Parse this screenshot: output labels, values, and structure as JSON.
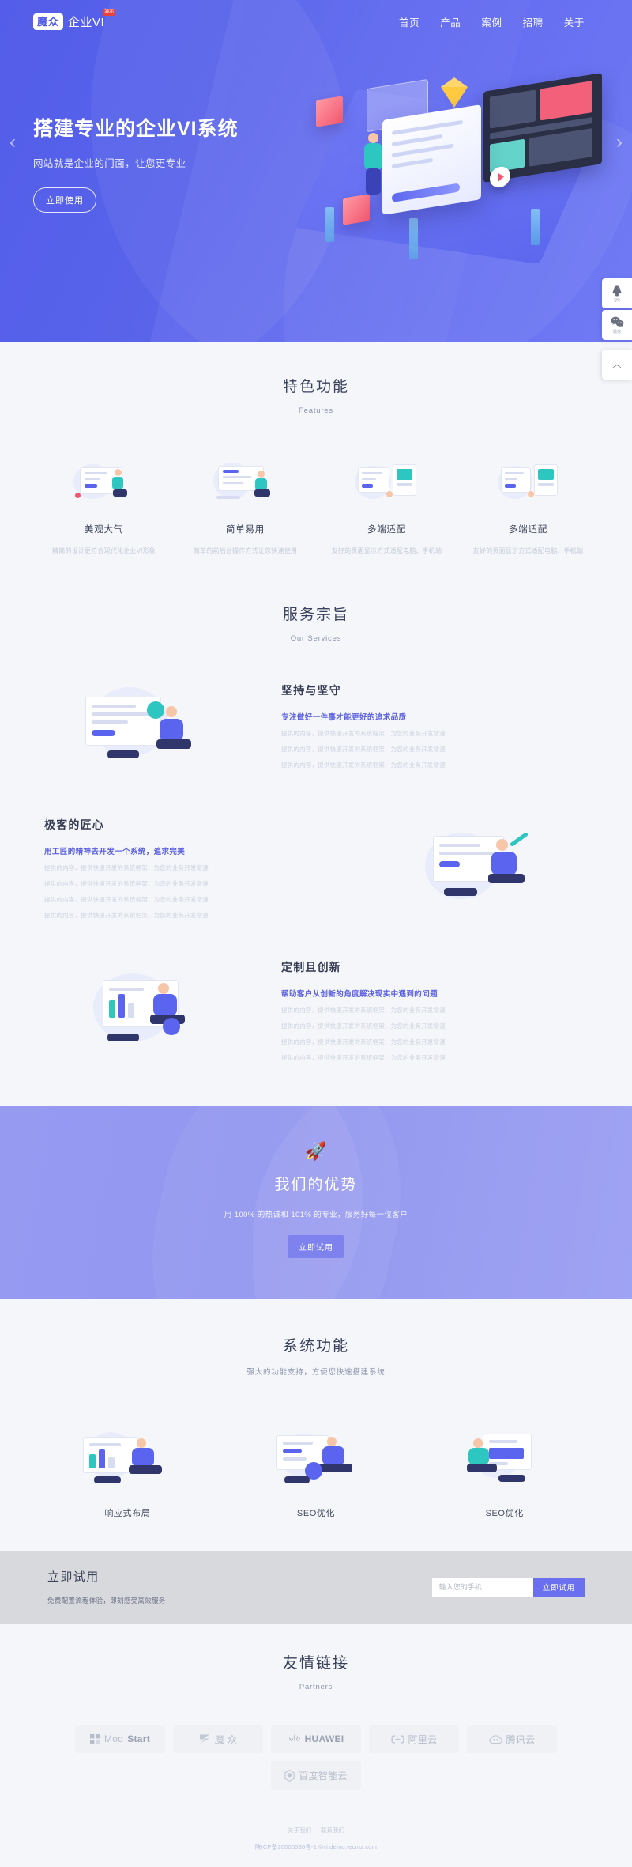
{
  "site": {
    "brand_mark": "魔众",
    "brand_name": "企业VI",
    "brand_badge": "演示"
  },
  "nav": {
    "items": [
      {
        "label": "首页"
      },
      {
        "label": "产品"
      },
      {
        "label": "案例"
      },
      {
        "label": "招聘"
      },
      {
        "label": "关于"
      }
    ]
  },
  "hero": {
    "title": "搭建专业的企业VI系统",
    "subtitle": "网站就是企业的门面，让您更专业",
    "button": "立即使用",
    "prev_arrow": "‹",
    "next_arrow": "›"
  },
  "side_widgets": {
    "qq_label": "QQ",
    "wechat_label": "微信",
    "top_arrow": "︿"
  },
  "features": {
    "title": "特色功能",
    "subtitle": "Features",
    "items": [
      {
        "title": "美观大气",
        "desc": "精简的设计更符合现代化企业VI形象"
      },
      {
        "title": "简单易用",
        "desc": "简单的前后台操作方式让您快速使用"
      },
      {
        "title": "多端适配",
        "desc": "友好的页面显示方式适配电脑、手机端"
      },
      {
        "title": "多端适配",
        "desc": "友好的页面显示方式适配电脑、手机端"
      }
    ]
  },
  "services": {
    "title": "服务宗旨",
    "subtitle": "Our Services",
    "items": [
      {
        "title": "坚持与坚守",
        "lead": "专注做好一件事才能更好的追求品质",
        "lines": [
          "提供的内容，提供快速开发的系统框架，为您的业务开发增速",
          "提供的内容，提供快速开发的系统框架，为您的业务开发增速",
          "提供的内容，提供快速开发的系统框架，为您的业务开发增速"
        ]
      },
      {
        "title": "极客的匠心",
        "lead": "用工匠的精神去开发一个系统，追求完美",
        "lines": [
          "提供的内容，提供快速开发的系统框架，为您的业务开发增速",
          "提供的内容，提供快速开发的系统框架，为您的业务开发增速",
          "提供的内容，提供快速开发的系统框架，为您的业务开发增速",
          "提供的内容，提供快速开发的系统框架，为您的业务开发增速"
        ]
      },
      {
        "title": "定制且创新",
        "lead": "帮助客户从创新的角度解决现实中遇到的问题",
        "lines": [
          "提供的内容，提供快速开发的系统框架，为您的业务开发增速",
          "提供的内容，提供快速开发的系统框架，为您的业务开发增速",
          "提供的内容，提供快速开发的系统框架，为您的业务开发增速",
          "提供的内容，提供快速开发的系统框架，为您的业务开发增速"
        ]
      }
    ]
  },
  "advantage": {
    "icon": "🚀",
    "title": "我们的优势",
    "subtitle": "用 100% 的热诚和 101% 的专业，服务好每一位客户",
    "button": "立即试用"
  },
  "sysfunc": {
    "title": "系统功能",
    "subtitle": "强大的功能支持，方便您快速搭建系统",
    "items": [
      {
        "title": "响应式布局"
      },
      {
        "title": "SEO优化"
      },
      {
        "title": "SEO优化"
      }
    ]
  },
  "trial": {
    "title": "立即试用",
    "subtitle": "免费配置流程体验，即刻感受高效服务",
    "input_placeholder": "输入您的手机",
    "input_value": "",
    "button": "立即试用"
  },
  "partners": {
    "title": "友情链接",
    "subtitle": "Partners",
    "items": [
      {
        "name": "ModStart",
        "prefix": "Mod",
        "suffix": "Start",
        "icon": "grid-icon"
      },
      {
        "name": "魔众",
        "prefix": "",
        "suffix": "魔 众",
        "icon": "mz-icon"
      },
      {
        "name": "HUAWEI",
        "prefix": "",
        "suffix": "HUAWEI",
        "icon": "huawei-icon"
      },
      {
        "name": "阿里云",
        "prefix": "",
        "suffix": "阿里云",
        "icon": "aliyun-icon"
      },
      {
        "name": "腾讯云",
        "prefix": "",
        "suffix": "腾讯云",
        "icon": "tencent-icon"
      },
      {
        "name": "百度智能云",
        "prefix": "",
        "suffix": "百度智能云",
        "icon": "baidu-icon"
      }
    ]
  },
  "footer": {
    "links": [
      {
        "label": "关于我们"
      },
      {
        "label": "联系我们"
      }
    ],
    "copyright": "陕ICP备20000530号-1 ©vi.demo.tecmz.com"
  },
  "colors": {
    "hero_bg": "#4f5ae9",
    "accent": "#5a64ee",
    "advantage_bg": "#8f93f0",
    "section_bg": "#f4f6f9",
    "trial_bg": "#d8d9dd"
  }
}
